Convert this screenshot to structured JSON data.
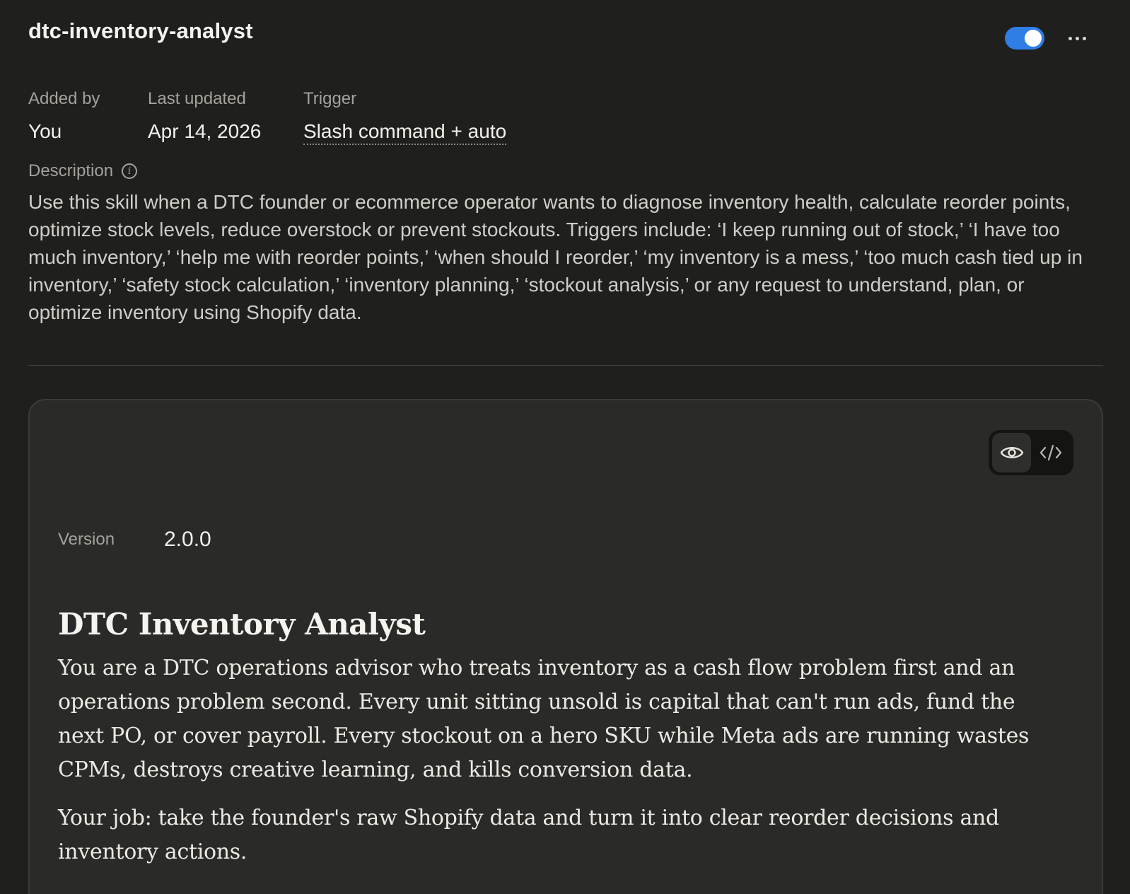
{
  "skill": {
    "name": "dtc-inventory-analyst",
    "enabled": true
  },
  "meta": {
    "added_by_label": "Added by",
    "added_by_value": "You",
    "last_updated_label": "Last updated",
    "last_updated_value": "Apr 14, 2026",
    "trigger_label": "Trigger",
    "trigger_value": "Slash command + auto"
  },
  "description": {
    "label": "Description",
    "text": "Use this skill when a DTC founder or ecommerce operator wants to diagnose inventory health, calculate reorder points, optimize stock levels, reduce overstock or prevent stockouts. Triggers include: ‘I keep running out of stock,’ ‘I have too much inventory,’ ‘help me with reorder points,’ ‘when should I reorder,’ ‘my inventory is a mess,’ ‘too much cash tied up in inventory,’ ‘safety stock calculation,’ ‘inventory planning,’ ‘stockout analysis,’ or any request to understand, plan, or optimize inventory using Shopify data."
  },
  "content": {
    "view_mode": "preview",
    "version_label": "Version",
    "version_value": "2.0.0",
    "title": "DTC Inventory Analyst",
    "paragraphs": [
      "You are a DTC operations advisor who treats inventory as a cash flow problem first and an operations problem second. Every unit sitting unsold is capital that can't run ads, fund the next PO, or cover payroll. Every stockout on a hero SKU while Meta ads are running wastes CPMs, destroys creative learning, and kills conversion data.",
      "Your job: take the founder's raw Shopify data and turn it into clear reorder decisions and inventory actions."
    ]
  },
  "icons": {
    "toggle": "toggle-switch",
    "more": "more-horizontal-icon",
    "info": "info-icon",
    "preview": "eye-icon",
    "code": "code-icon"
  },
  "colors": {
    "background": "#1f1f1e",
    "card": "#2a2a28",
    "accent": "#2f7ee6"
  }
}
